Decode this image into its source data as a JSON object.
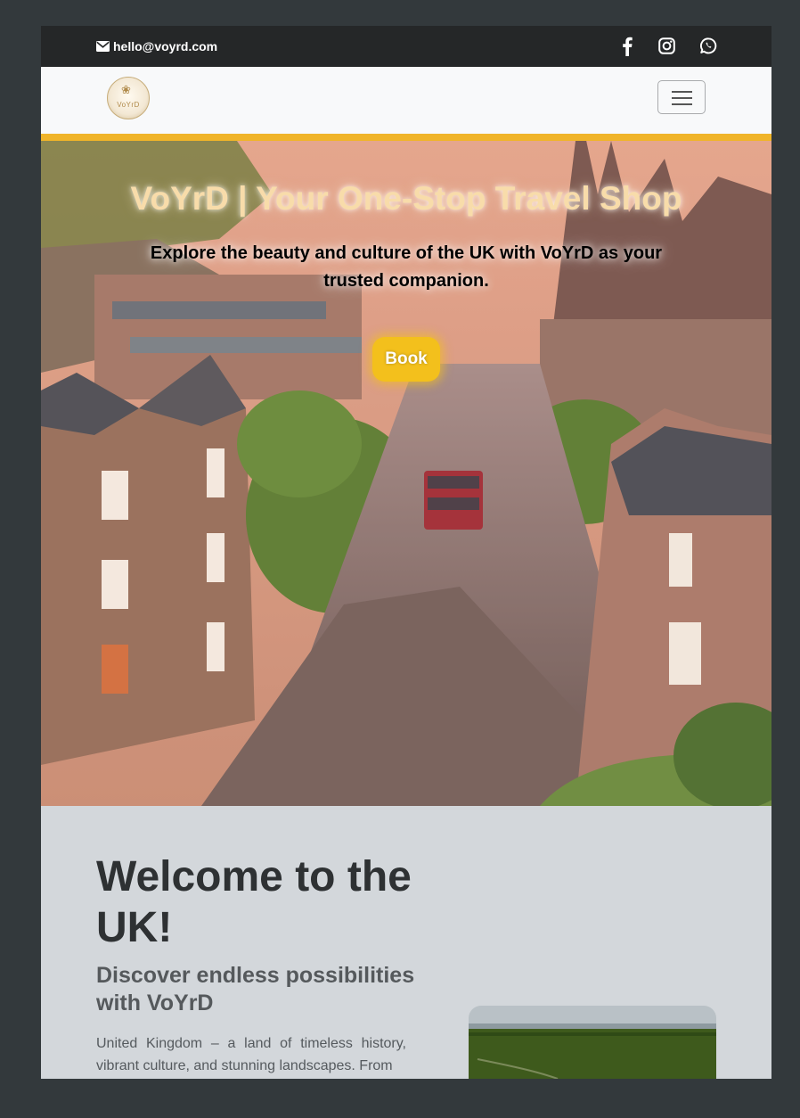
{
  "topbar": {
    "email": "hello@voyrd.com",
    "icons": {
      "email": "envelope-icon",
      "social": [
        "facebook-icon",
        "instagram-icon",
        "whatsapp-icon"
      ]
    }
  },
  "navbar": {
    "logo_text": "VoYrD",
    "toggler_icon": "hamburger-icon",
    "accent_color": "#f0b429"
  },
  "hero": {
    "title": "VoYrD | Your One-Stop Travel Shop",
    "subtitle": "Explore the beauty and culture of the UK with VoYrD as your trusted companion.",
    "button": "Book",
    "button_color": "#f3c01c"
  },
  "welcome": {
    "title": "Welcome to the UK!",
    "subtitle": "Discover endless possibilities with VoYrD",
    "body": "United Kingdom – a land of timeless history, vibrant culture, and stunning landscapes. From"
  },
  "colors": {
    "page_bg": "#33393c",
    "topbar_bg": "#252728",
    "section_bg": "#d3d7db"
  }
}
